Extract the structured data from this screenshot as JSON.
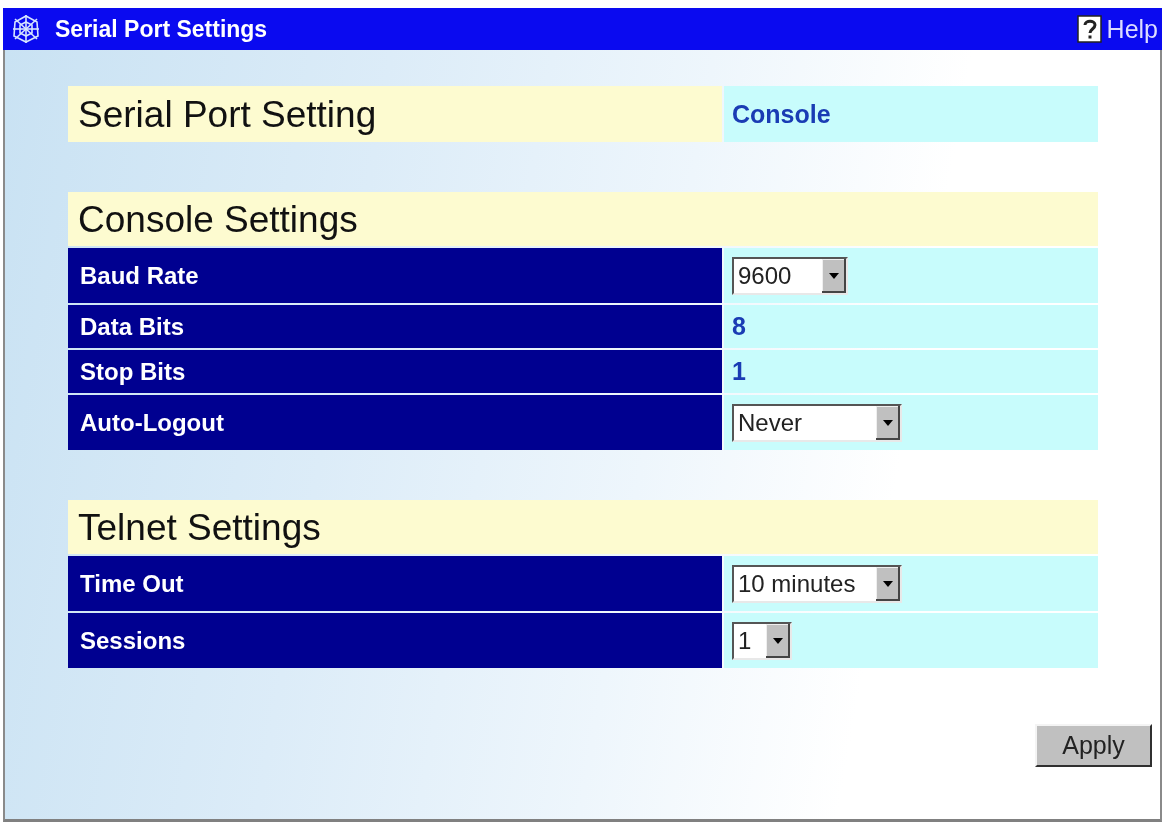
{
  "window": {
    "title": "Serial Port Settings",
    "help": "Help"
  },
  "serial_port": {
    "label": "Serial Port Setting",
    "value": "Console"
  },
  "sections": [
    {
      "title": "Console Settings",
      "rows": [
        {
          "label": "Baud Rate",
          "kind": "select",
          "value": "9600"
        },
        {
          "label": "Data Bits",
          "kind": "text",
          "value": "8"
        },
        {
          "label": "Stop Bits",
          "kind": "text",
          "value": "1"
        },
        {
          "label": "Auto-Logout",
          "kind": "select",
          "value": "Never"
        }
      ]
    },
    {
      "title": "Telnet Settings",
      "rows": [
        {
          "label": "Time Out",
          "kind": "select",
          "value": "10 minutes"
        },
        {
          "label": "Sessions",
          "kind": "select",
          "value": "1"
        }
      ]
    }
  ],
  "buttons": [
    "Apply"
  ]
}
